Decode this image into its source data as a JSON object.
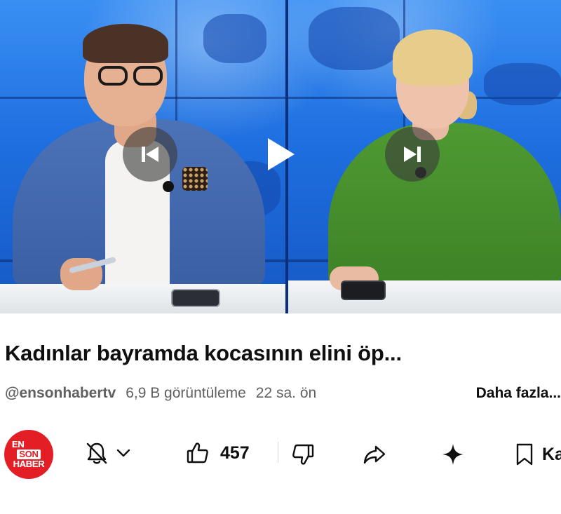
{
  "video": {
    "controls": {
      "previous_icon": "skip-previous-icon",
      "play_icon": "play-icon",
      "next_icon": "skip-next-icon"
    }
  },
  "title": "Kadınlar bayramda kocasının elini öp...",
  "meta": {
    "channel": "@ensonhabertv",
    "views": "6,9 B görüntüleme",
    "age": "22 sa. ön",
    "more": "Daha fazla..."
  },
  "channel_avatar": {
    "line1": "EN",
    "line2": "SON",
    "line3": "HABER",
    "color": "#e31e24"
  },
  "actions": {
    "subscribe_icon": "bell-off-icon",
    "dropdown_icon": "chevron-down-icon",
    "like_icon": "thumbs-up-icon",
    "like_count": "457",
    "dislike_icon": "thumbs-down-icon",
    "share_icon": "share-icon",
    "remix_icon": "sparkle-icon",
    "save_icon": "bookmark-icon",
    "save_label": "Ka"
  }
}
